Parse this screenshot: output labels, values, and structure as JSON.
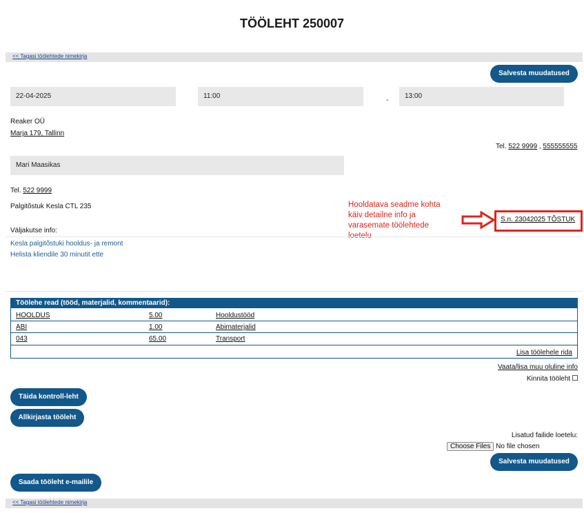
{
  "title": "TÖÖLEHT 250007",
  "back_link": "<< Tagasi töölehtede nimekirja",
  "save_button": "Salvesta muudatused",
  "date": "22-04-2025",
  "time_start": "11:00",
  "time_separator": "-",
  "time_end": "13:00",
  "client": {
    "company": "Reaker OÜ",
    "address": "Marja 179, Tallinn",
    "phone_label": "Tel.",
    "phone_1": "522 9999",
    "phone_sep": ",",
    "phone_2": "555555555"
  },
  "contact": {
    "name": "Mari Maasikas",
    "phone_label": "Tel.",
    "phone": "522 9999"
  },
  "device": {
    "name": "Palgitõstuk Kesla CTL 235",
    "serial_link": "S.n. 23042025  TÕSTUK"
  },
  "annotation": {
    "text": "Hooldatava seadme kohta käiv detailne info ja varasemate töölehtede loetelu",
    "color": "#e0241c"
  },
  "callout": {
    "label": "Väljakutse info:",
    "line_1": "Kesla palgitõstuki hooldus- ja remont",
    "line_2": "Helista kliendile 30 minutit ette"
  },
  "rows_table": {
    "header": "Töölehe read (tööd, materjalid, kommentaarid):",
    "rows": [
      {
        "code": "HOOLDUS",
        "qty": "5.00",
        "desc": "Hooldustööd"
      },
      {
        "code": "ABI",
        "qty": "1.00",
        "desc": "Abimaterjalid"
      },
      {
        "code": "043",
        "qty": "65.00",
        "desc": "Transport"
      }
    ],
    "add_row": "Lisa töölehele rida"
  },
  "other_info_link": "Vaata/lisa muu oluline info",
  "confirm_label": "Kinnita tööleht",
  "fill_checklist_button": "Täida kontroll-leht",
  "sign_button": "Allkirjasta tööleht",
  "files": {
    "label": "Lisatud failide loetelu:",
    "choose_button": "Choose Files",
    "status": "No file chosen"
  },
  "send_email_button": "Saada tööleht e-mailile",
  "colors": {
    "primary": "#12588a",
    "field_bg": "#e8e8e8",
    "link_blue": "#1d5f95"
  }
}
